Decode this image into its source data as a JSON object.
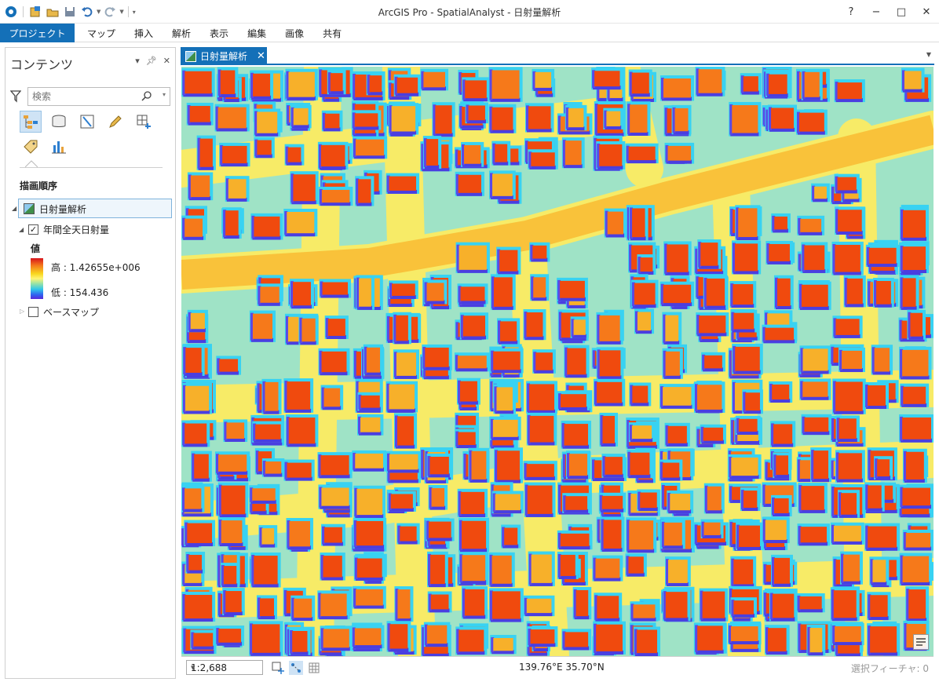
{
  "window": {
    "title": "ArcGIS Pro - SpatialAnalyst - 日射量解析",
    "help": "?",
    "minimize": "−",
    "maximize": "□",
    "close": "✕"
  },
  "ribbon": {
    "tabs": [
      "プロジェクト",
      "マップ",
      "挿入",
      "解析",
      "表示",
      "編集",
      "画像",
      "共有"
    ]
  },
  "contents": {
    "title": "コンテンツ",
    "search_placeholder": "検索",
    "section": "描画順序",
    "map_name": "日射量解析",
    "layer_name": "年間全天日射量",
    "layer_checked": true,
    "legend_title": "値",
    "legend_high": "高 : 1.42655e+006",
    "legend_low": "低 : 154.436",
    "basemap": "ベースマップ",
    "basemap_checked": false
  },
  "map_view": {
    "tab_label": "日射量解析"
  },
  "status_bar": {
    "scale": "1:2,688",
    "coordinates": "139.76°E 35.70°N",
    "selected_features": "選択フィーチャ: 0"
  },
  "colors": {
    "accent": "#1470b8",
    "building": "#f04a0e",
    "road": "#f5e65a",
    "shadow": "#4a3ee0",
    "halo": "#38d2f2"
  }
}
